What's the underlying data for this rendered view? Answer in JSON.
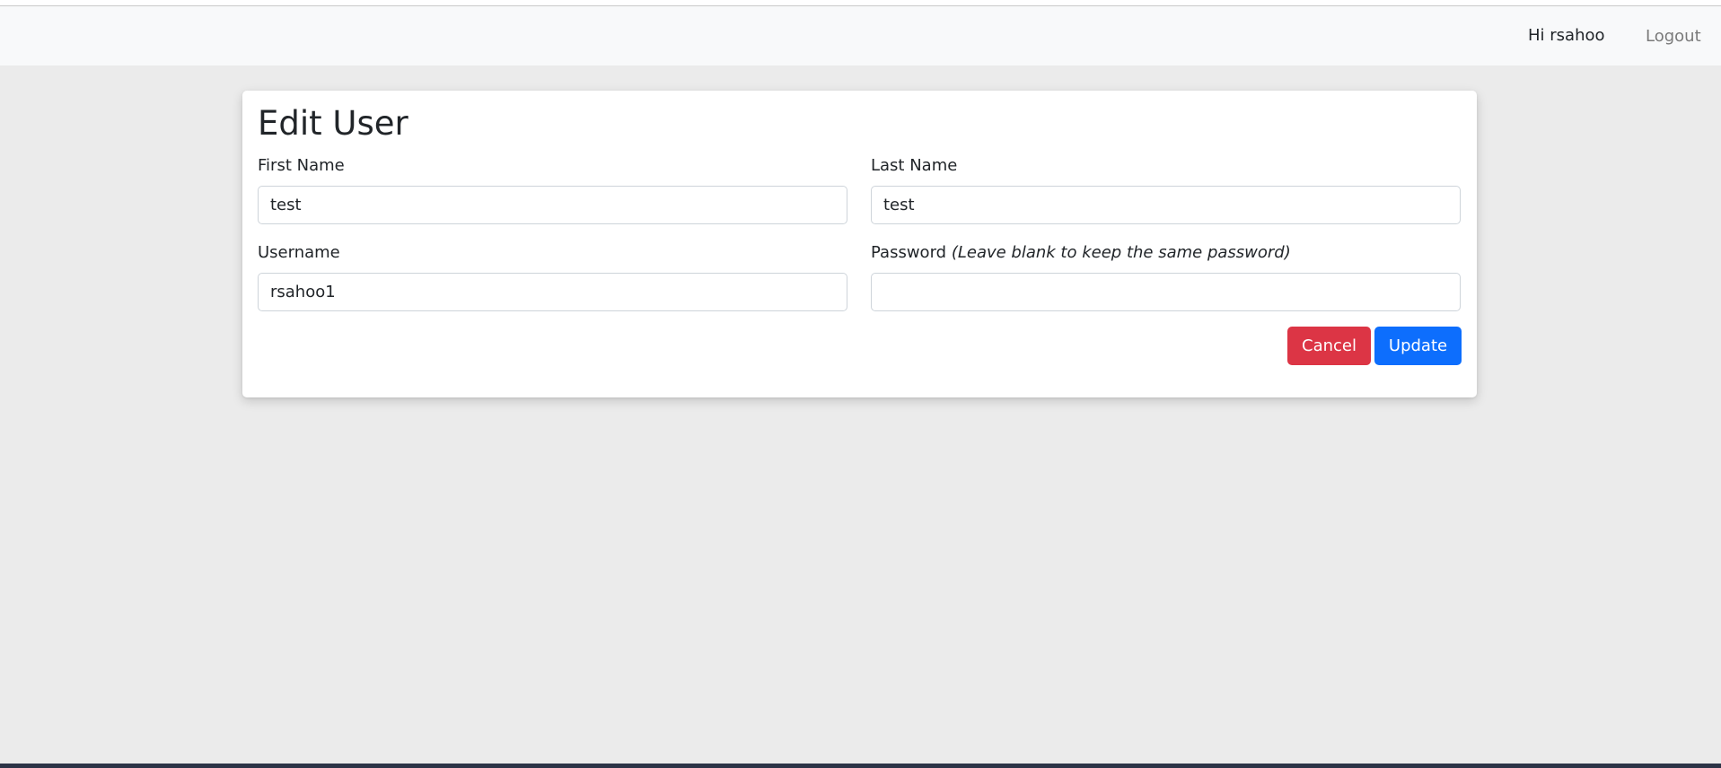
{
  "navbar": {
    "greeting": "Hi rsahoo",
    "logout_label": "Logout"
  },
  "form": {
    "title": "Edit User",
    "first_name": {
      "label": "First Name",
      "value": "test"
    },
    "last_name": {
      "label": "Last Name",
      "value": "test"
    },
    "username": {
      "label": "Username",
      "value": "rsahoo1"
    },
    "password": {
      "label": "Password",
      "hint": "(Leave blank to keep the same password)",
      "value": ""
    },
    "cancel_label": "Cancel",
    "update_label": "Update"
  },
  "colors": {
    "cancel": "#dc3545",
    "update": "#0d6efd",
    "background": "#ebebeb",
    "navbar": "#f8f9fa"
  }
}
